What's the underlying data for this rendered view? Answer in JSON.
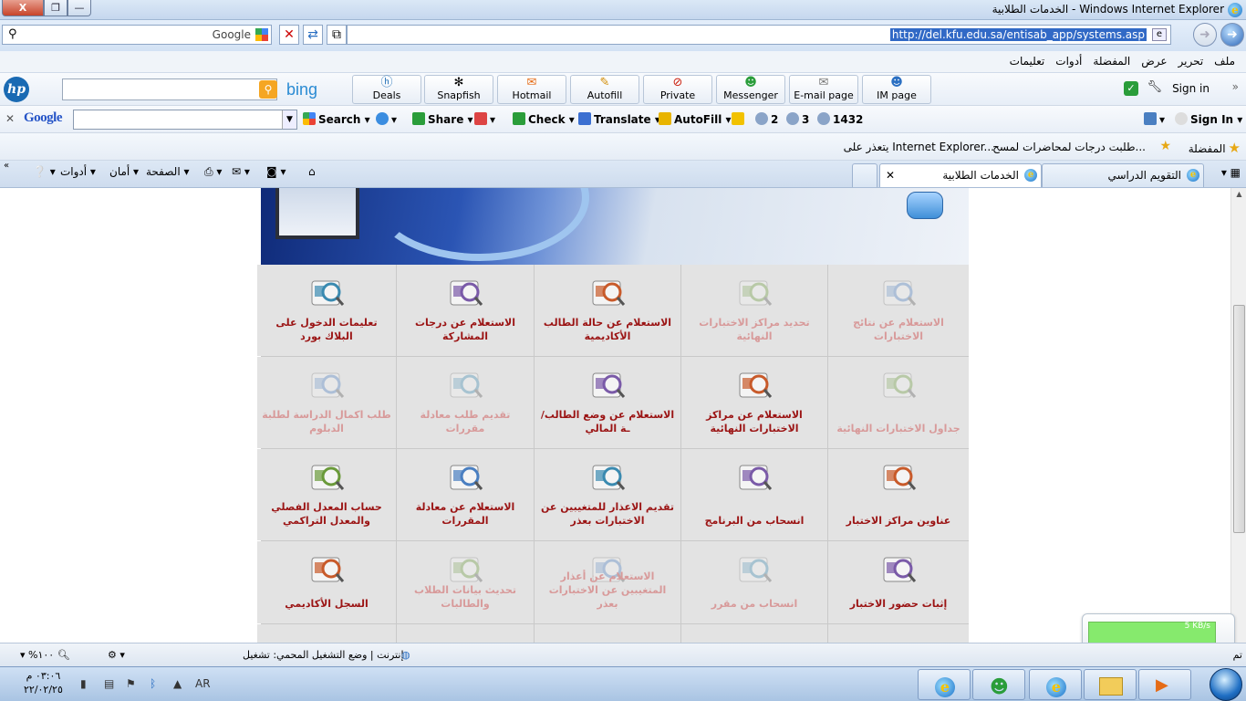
{
  "window": {
    "title": "الخدمات الطلابية - Windows Internet Explorer",
    "close_label": "X",
    "max_label": "❐",
    "min_label": "—"
  },
  "address": {
    "search_provider": "Google",
    "url": "http://del.kfu.edu.sa/entisab_app/systems.asp"
  },
  "menu": [
    "ملف",
    "تحرير",
    "عرض",
    "المفضلة",
    "أدوات",
    "تعليمات"
  ],
  "hp_toolbar": {
    "bing_label": "bing",
    "buttons": [
      "Deals",
      "Snapfish",
      "Hotmail",
      "Autofill",
      "Private",
      "Messenger",
      "E-mail page",
      "IM page"
    ],
    "sign_in": "Sign in"
  },
  "google_toolbar": {
    "logo": "Google",
    "search": "Search",
    "share": "Share",
    "check": "Check",
    "translate": "Translate",
    "autofill": "AutoFill",
    "count_a": "2",
    "count_b": "3",
    "count_c": "1432",
    "sign_in": "Sign In"
  },
  "favorites": {
    "label": "المفضلة",
    "links": [
      "طلبت درجات لمحاضرات لمسح...",
      "يتعذر على Internet Explorer..."
    ]
  },
  "tabs": {
    "active": "الخدمات الطلابية",
    "other": "التقويم الدراسي"
  },
  "command_bar": {
    "page": "الصفحة",
    "safety": "أمان",
    "tools": "أدوات"
  },
  "grid": {
    "rows": [
      [
        {
          "label": "الاستعلام عن نتائج الاختبارات",
          "dim": true,
          "icon": "exam-results-icon"
        },
        {
          "label": "تحديد مراكز الاختبارات النهائية",
          "dim": true,
          "icon": "exam-centers-select-icon"
        },
        {
          "label": "الاستعلام عن حالة الطالب الأكاديمية",
          "dim": false,
          "icon": "academic-status-icon"
        },
        {
          "label": "الاستعلام عن درجات المشاركة",
          "dim": false,
          "icon": "participation-grades-icon"
        },
        {
          "label": "تعليمات الدخول على البلاك بورد",
          "dim": false,
          "icon": "blackboard-icon"
        }
      ],
      [
        {
          "label": "جداول الاختبارات النهائية",
          "dim": true,
          "icon": "final-exams-schedule-icon"
        },
        {
          "label": "الاستعلام عن مراكز الاختبارات النهائية",
          "dim": false,
          "icon": "exam-centers-query-icon"
        },
        {
          "label": "الاستعلام عن وضع الطالب/ـة المالي",
          "dim": false,
          "icon": "financial-status-icon"
        },
        {
          "label": "تقديم طلب معادلة مقررات",
          "dim": true,
          "icon": "course-equivalency-request-icon"
        },
        {
          "label": "طلب اكمال الدراسة لطلبة الدبلوم",
          "dim": true,
          "icon": "diploma-continue-icon"
        }
      ],
      [
        {
          "label": "عناوين مراكز الاختبار",
          "dim": false,
          "icon": "exam-center-addresses-icon"
        },
        {
          "label": "انسحاب من البرنامج",
          "dim": false,
          "icon": "program-withdrawal-icon"
        },
        {
          "label": "تقديم الاعذار للمتغيبين عن الاختبارات بعذر",
          "dim": false,
          "icon": "excuse-submit-icon"
        },
        {
          "label": "الاستعلام عن معادلة المقررات",
          "dim": false,
          "icon": "course-equivalency-query-icon"
        },
        {
          "label": "حساب المعدل الفصلي والمعدل التراكمي",
          "dim": false,
          "icon": "gpa-calculator-icon"
        }
      ],
      [
        {
          "label": "إثبات حضور الاختبار",
          "dim": false,
          "icon": "exam-attendance-icon"
        },
        {
          "label": "انسحاب من مقرر",
          "dim": true,
          "icon": "course-withdrawal-icon"
        },
        {
          "label": "الاستعلام عن أعذار المتغيبين عن الاختبارات بعذر",
          "dim": true,
          "icon": "excuse-query-icon"
        },
        {
          "label": "تحديث بيانات الطلاب والطالبات",
          "dim": true,
          "icon": "update-data-icon"
        },
        {
          "label": "السجل الأكاديمي",
          "dim": false,
          "icon": "academic-record-icon"
        }
      ]
    ]
  },
  "status": {
    "done": "تم",
    "zone": "إنترنت | وضع التشغيل المحمي: تشغيل",
    "zoom": "%١٠٠"
  },
  "gadget": {
    "rate": "5 KB/s"
  },
  "taskbar": {
    "lang": "AR",
    "time": "٠٣:٠٦ م",
    "date": "٢٢/٠٢/٢٥"
  },
  "colors": {
    "label_active": "#9b1414",
    "label_dim": "#d89a9a",
    "url_highlight": "#3169c6"
  }
}
